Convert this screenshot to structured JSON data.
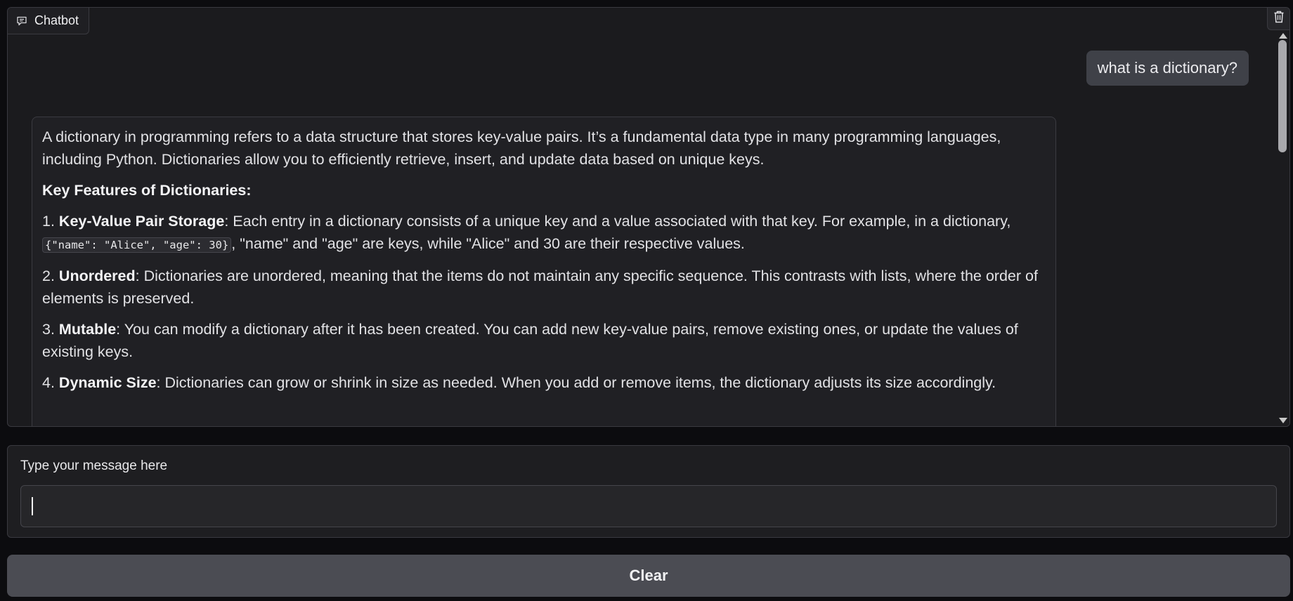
{
  "chatbot": {
    "label": "Chatbot",
    "icon": "chat-bubble-icon",
    "clear_icon": "trash-icon"
  },
  "messages": {
    "user": "what is a dictionary?",
    "bot": {
      "intro": "A dictionary in programming refers to a data structure that stores key-value pairs. It’s a fundamental data type in many programming languages, including Python. Dictionaries allow you to efficiently retrieve, insert, and update data based on unique keys.",
      "heading": "Key Features of Dictionaries:",
      "features": [
        {
          "num": "1.",
          "term": "Key-Value Pair Storage",
          "text_before": ": Each entry in a dictionary consists of a unique key and a value associated with that key. For example, in a dictionary, ",
          "code": "{\"name\": \"Alice\", \"age\": 30}",
          "text_after": ", \"name\" and \"age\" are keys, while \"Alice\" and 30 are their respective values."
        },
        {
          "num": "2.",
          "term": "Unordered",
          "text": ": Dictionaries are unordered, meaning that the items do not maintain any specific sequence. This contrasts with lists, where the order of elements is preserved."
        },
        {
          "num": "3.",
          "term": "Mutable",
          "text": ": You can modify a dictionary after it has been created. You can add new key-value pairs, remove existing ones, or update the values of existing keys."
        },
        {
          "num": "4.",
          "term": "Dynamic Size",
          "text": ": Dictionaries can grow or shrink in size as needed. When you add or remove items, the dictionary adjusts its size accordingly."
        }
      ]
    }
  },
  "input": {
    "label": "Type your message here",
    "value": "",
    "placeholder": ""
  },
  "buttons": {
    "clear": "Clear"
  }
}
